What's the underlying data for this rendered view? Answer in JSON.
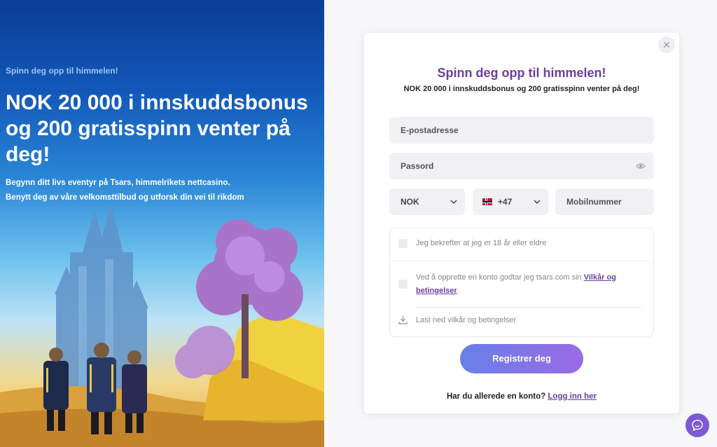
{
  "hero": {
    "eyebrow": "Spinn deg opp til himmelen!",
    "title": "NOK 20 000 i innskuddsbonus og 200 gratisspinn venter på deg!",
    "line1": "Begynn ditt livs eventyr på Tsars, himmelrikets nettcasino.",
    "line2": "Benytt deg av våre velkomsttilbud og utforsk din vei til rikdom"
  },
  "card": {
    "close_icon": "close-icon",
    "title": "Spinn deg opp til himmelen!",
    "subtitle": "NOK 20 000 i innskuddsbonus og 200 gratisspinn venter på deg!",
    "email_placeholder": "E-postadresse",
    "password_placeholder": "Passord",
    "currency": "NOK",
    "phone_code": "+47",
    "mobile_placeholder": "Mobilnummer",
    "age_confirm": "Jeg bekrefter at jeg er 18 år eller eldre",
    "terms_prefix": "Ved å opprette en konto godtar jeg tsars.com sin ",
    "terms_link": "Vilkår og betingelser",
    "terms_suffix": ".",
    "download_terms": "Last ned vilkår og betingelser",
    "register_label": "Registrer deg",
    "login_prefix": "Har du allerede en konto?",
    "login_link": "Logg inn her"
  },
  "colors": {
    "accent": "#6b3fa0",
    "button_start": "#6a7fe8",
    "button_end": "#9a6ae6"
  }
}
